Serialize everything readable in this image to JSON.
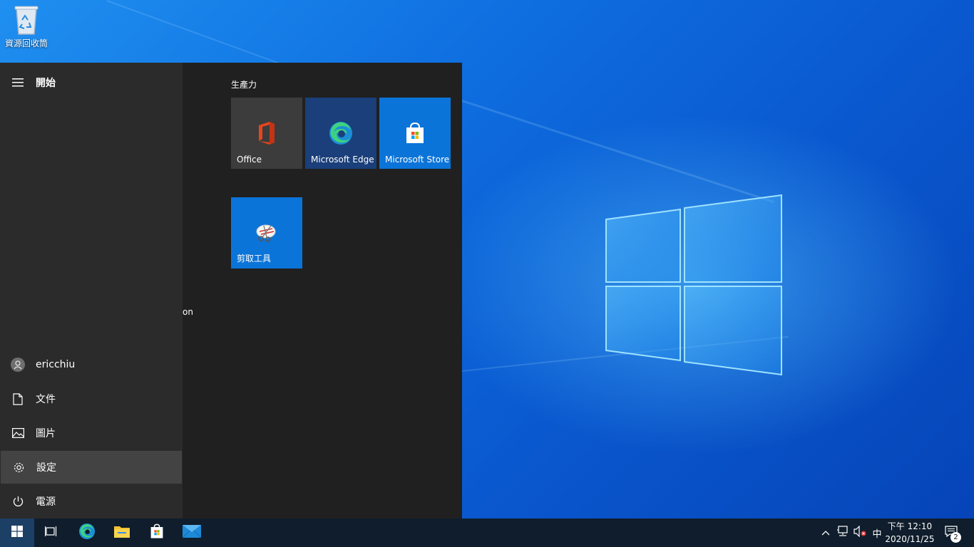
{
  "desktop": {
    "recycle_bin_label": "資源回收筒"
  },
  "start_menu": {
    "header_label": "開始",
    "user_name": "ericchiu",
    "rail_items": [
      {
        "label": "文件",
        "icon": "document-icon"
      },
      {
        "label": "圖片",
        "icon": "pictures-icon"
      },
      {
        "label": "設定",
        "icon": "gear-icon"
      },
      {
        "label": "電源",
        "icon": "power-icon"
      }
    ],
    "app_list_fragment": "on",
    "group_title": "生產力",
    "tiles": [
      {
        "label": "Office",
        "icon": "office-icon",
        "color": "#3c3c3c"
      },
      {
        "label": "Microsoft Edge",
        "icon": "edge-icon",
        "color": "#1a3f7a"
      },
      {
        "label": "Microsoft Store",
        "icon": "store-icon",
        "color": "#0b74d8"
      },
      {
        "label": "剪取工具",
        "icon": "snipping-tool-icon",
        "color": "#0b74d8"
      }
    ]
  },
  "taskbar": {
    "input_indicator": "中",
    "time": "下午 12:10",
    "date": "2020/11/25",
    "notification_count": "2"
  },
  "colors": {
    "start_bg": "#202020",
    "rail_bg": "#2b2b2b",
    "active_item_bg": "#434343",
    "taskbar_bg": "#0f1d2c",
    "accent_blue": "#0b74d8"
  }
}
